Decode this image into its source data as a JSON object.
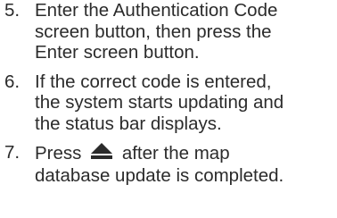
{
  "steps": [
    {
      "number": "5.",
      "lines": [
        "Enter the Authentication Code",
        "screen button, then press the",
        "Enter screen button."
      ]
    },
    {
      "number": "6.",
      "lines": [
        "If the correct code is entered,",
        "the system starts updating and",
        "the status bar displays."
      ]
    },
    {
      "number": "7.",
      "line1_before_icon": "Press",
      "icon": "eject-icon",
      "line1_after_icon": "after the map",
      "line2": "database update is completed."
    }
  ]
}
